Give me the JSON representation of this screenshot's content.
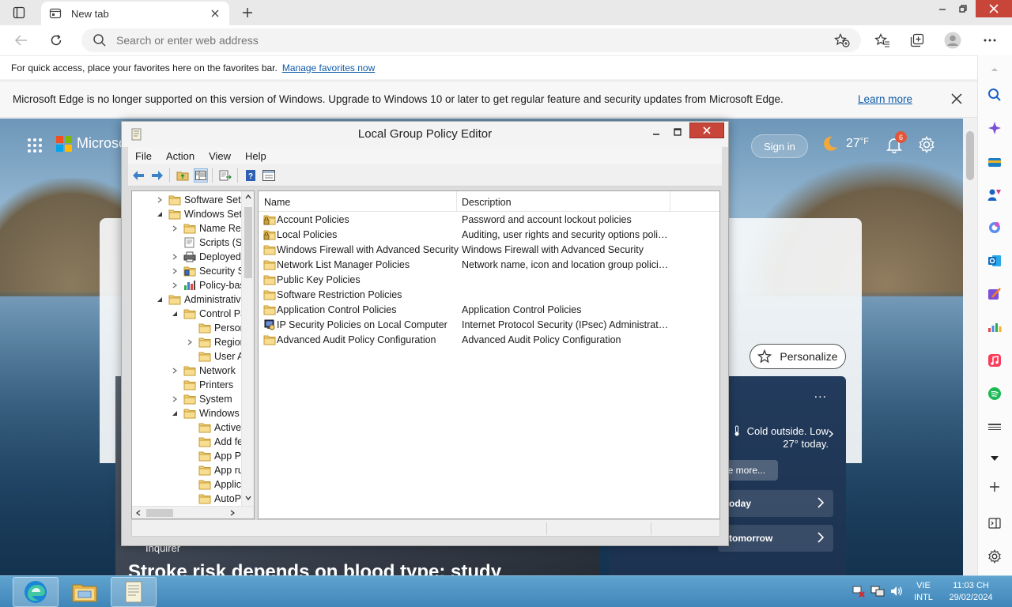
{
  "browser": {
    "tab": {
      "title": "New tab"
    },
    "address_bar": {
      "placeholder": "Search or enter web address"
    },
    "favorites_bar": {
      "message": "For quick access, place your favorites here on the favorites bar.",
      "link": "Manage favorites now"
    },
    "info_bar": {
      "message": "Microsoft Edge is no longer supported on this version of Windows. Upgrade to Windows 10 or later to get regular feature and security updates from Microsoft Edge.",
      "link": "Learn more"
    }
  },
  "new_tab_page": {
    "logo_text": "Microso",
    "sign_in": "Sign in",
    "temperature": "27",
    "temperature_unit": "°F",
    "notification_count": "6",
    "personalize": "Personalize",
    "news": {
      "source": "Inquirer",
      "headline": "Stroke risk depends on blood type: study"
    },
    "weather_card": {
      "more": "...",
      "summary": "Cold outside. Low 27° today.",
      "see_more": "ee more...",
      "today": "oday",
      "tomorrow": "tomorrow"
    }
  },
  "gpe": {
    "title": "Local Group Policy Editor",
    "menu": [
      "File",
      "Action",
      "View",
      "Help"
    ],
    "tree": [
      {
        "label": "Software Setti",
        "indent": 0,
        "expander": "collapsed",
        "icon": "folder-icon"
      },
      {
        "label": "Windows Sett",
        "indent": 0,
        "expander": "expanded",
        "icon": "folder-icon"
      },
      {
        "label": "Name Res",
        "indent": 1,
        "expander": "collapsed",
        "icon": "folder-icon"
      },
      {
        "label": "Scripts (Sta",
        "indent": 1,
        "expander": "none",
        "icon": "scripts-icon"
      },
      {
        "label": "Deployed",
        "indent": 1,
        "expander": "collapsed",
        "icon": "printer-icon"
      },
      {
        "label": "Security Se",
        "indent": 1,
        "expander": "collapsed",
        "icon": "security-icon"
      },
      {
        "label": "Policy-bas",
        "indent": 1,
        "expander": "collapsed",
        "icon": "qos-chart-icon"
      },
      {
        "label": "Administrative",
        "indent": 0,
        "expander": "expanded",
        "icon": "folder-icon"
      },
      {
        "label": "Control Pa",
        "indent": 1,
        "expander": "expanded",
        "icon": "folder-icon"
      },
      {
        "label": "Person",
        "indent": 2,
        "expander": "none",
        "icon": "folder-icon"
      },
      {
        "label": "Region",
        "indent": 2,
        "expander": "collapsed",
        "icon": "folder-icon"
      },
      {
        "label": "User A",
        "indent": 2,
        "expander": "none",
        "icon": "folder-icon"
      },
      {
        "label": "Network",
        "indent": 1,
        "expander": "collapsed",
        "icon": "folder-icon"
      },
      {
        "label": "Printers",
        "indent": 1,
        "expander": "none",
        "icon": "folder-icon"
      },
      {
        "label": "System",
        "indent": 1,
        "expander": "collapsed",
        "icon": "folder-icon"
      },
      {
        "label": "Windows C",
        "indent": 1,
        "expander": "expanded",
        "icon": "folder-icon"
      },
      {
        "label": "ActiveX",
        "indent": 2,
        "expander": "none",
        "icon": "folder-icon"
      },
      {
        "label": "Add fe",
        "indent": 2,
        "expander": "none",
        "icon": "folder-icon"
      },
      {
        "label": "App Pa",
        "indent": 2,
        "expander": "none",
        "icon": "folder-icon"
      },
      {
        "label": "App ru",
        "indent": 2,
        "expander": "none",
        "icon": "folder-icon"
      },
      {
        "label": "Applic",
        "indent": 2,
        "expander": "none",
        "icon": "folder-icon"
      },
      {
        "label": "AutoPl",
        "indent": 2,
        "expander": "none",
        "icon": "folder-icon"
      }
    ],
    "columns": {
      "name": "Name",
      "description": "Description"
    },
    "items": [
      {
        "name": "Account Policies",
        "description": "Password and account lockout policies",
        "icon": "locked-folder-icon"
      },
      {
        "name": "Local Policies",
        "description": "Auditing, user rights and security options polici...",
        "icon": "locked-folder-icon"
      },
      {
        "name": "Windows Firewall with Advanced Security",
        "description": "Windows Firewall with Advanced Security",
        "icon": "folder-icon"
      },
      {
        "name": "Network List Manager Policies",
        "description": "Network name, icon and location group policies.",
        "icon": "folder-icon"
      },
      {
        "name": "Public Key Policies",
        "description": "",
        "icon": "folder-icon"
      },
      {
        "name": "Software Restriction Policies",
        "description": "",
        "icon": "folder-icon"
      },
      {
        "name": "Application Control Policies",
        "description": "Application Control Policies",
        "icon": "folder-icon"
      },
      {
        "name": "IP Security Policies on Local Computer",
        "description": "Internet Protocol Security (IPsec) Administratio...",
        "icon": "ipsec-icon"
      },
      {
        "name": "Advanced Audit Policy Configuration",
        "description": "Advanced Audit Policy Configuration",
        "icon": "folder-icon"
      }
    ]
  },
  "taskbar": {
    "language": "VIE",
    "keyboard": "INTL",
    "time": "11:03 CH",
    "date": "29/02/2024"
  },
  "colors": {
    "accent": "#0f5ba8",
    "taskbar": "#4a8fc2",
    "folder": "#e9c46a"
  }
}
